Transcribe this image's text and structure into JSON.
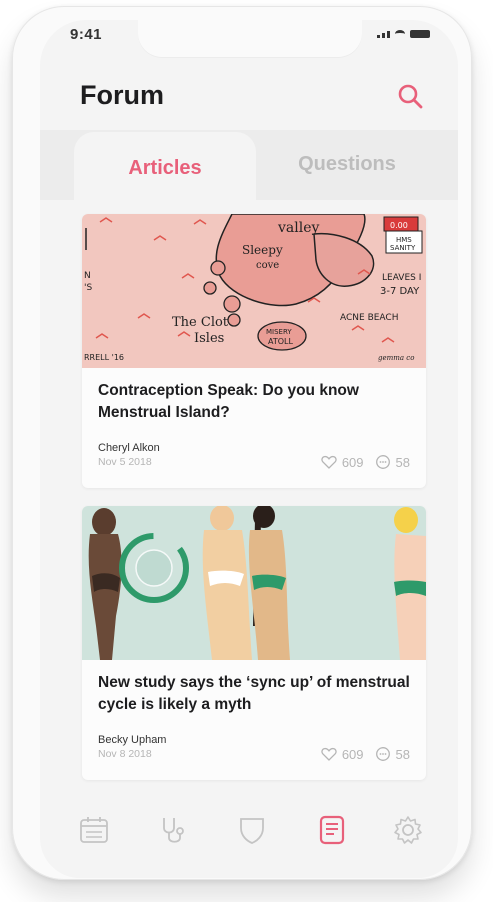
{
  "status": {
    "time": "9:41"
  },
  "header": {
    "title": "Forum",
    "search_icon": "search-icon"
  },
  "tabs": [
    {
      "label": "Articles",
      "active": true
    },
    {
      "label": "Questions",
      "active": false
    }
  ],
  "articles": [
    {
      "image_labels": [
        "valley",
        "Sleepy",
        "cove",
        "N",
        "'S",
        "The Clot",
        "Isles",
        "MISERY",
        "ATOLL",
        "ACNE BEACH",
        "LEAVES I",
        "3-7 DAY",
        "HMS",
        "SANITY",
        "0.00",
        "RRELL '16",
        "gemma co"
      ],
      "title": "Contraception Speak: Do you know Menstrual Island?",
      "author": "Cheryl Alkon",
      "date": "Nov 5 2018",
      "likes": "609",
      "comments": "58"
    },
    {
      "title": "New study says the ‘sync up’ of menstrual cycle is likely a myth",
      "author": "Becky Upham",
      "date": "Nov 8 2018",
      "likes": "609",
      "comments": "58"
    }
  ],
  "nav": [
    {
      "icon": "calendar-icon",
      "active": false
    },
    {
      "icon": "stethoscope-icon",
      "active": false
    },
    {
      "icon": "shield-icon",
      "active": false
    },
    {
      "icon": "article-icon",
      "active": true
    },
    {
      "icon": "gear-icon",
      "active": false
    }
  ],
  "colors": {
    "accent": "#e8607a",
    "muted": "#bdbdbd",
    "map_bg": "#f2c7bf",
    "teal_bg": "#cfe3dc"
  }
}
